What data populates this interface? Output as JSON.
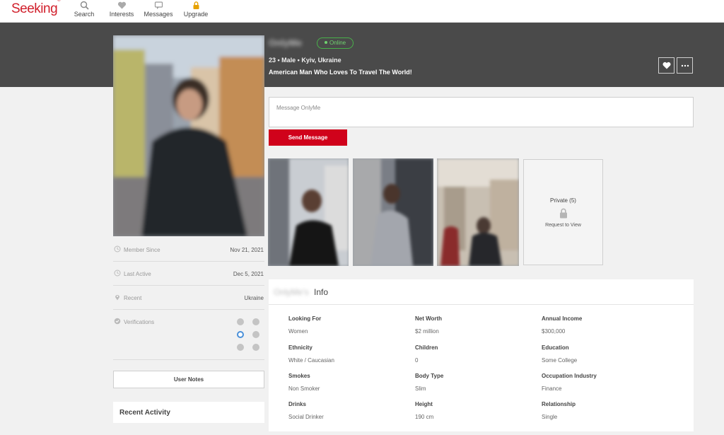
{
  "brand": {
    "logo": "Seeking",
    "color": "#d11f2b"
  },
  "nav": [
    {
      "label": "Search",
      "icon": "search-icon"
    },
    {
      "label": "Interests",
      "icon": "heart-icon"
    },
    {
      "label": "Messages",
      "icon": "chat-icon"
    },
    {
      "label": "Upgrade",
      "icon": "lock-icon"
    }
  ],
  "profile": {
    "username": "OnlyMe",
    "status": "Online",
    "meta": "23 • Male • Kyiv, Ukraine",
    "tagline": "American Man Who Loves To Travel The World!"
  },
  "message": {
    "placeholder": "Message OnlyMe",
    "send_label": "Send Message"
  },
  "gallery": {
    "private_label": "Private (5)",
    "request_label": "Request to View"
  },
  "details": [
    {
      "label": "Member Since",
      "value": "Nov 21, 2021",
      "icon": "clock-icon"
    },
    {
      "label": "Last Active",
      "value": "Dec 5, 2021",
      "icon": "clock-icon"
    },
    {
      "label": "Recent",
      "value": "Ukraine",
      "icon": "location-pin-icon"
    },
    {
      "label": "Verifications",
      "value": "",
      "icon": "check-circle-icon"
    }
  ],
  "user_notes_label": "User Notes",
  "recent_activity_label": "Recent Activity",
  "info": {
    "name": "OnlyMe's",
    "title": "Info",
    "fields": [
      {
        "label": "Looking For",
        "value": "Women"
      },
      {
        "label": "Net Worth",
        "value": "$2 million"
      },
      {
        "label": "Annual Income",
        "value": "$300,000"
      },
      {
        "label": "Ethnicity",
        "value": "White / Caucasian"
      },
      {
        "label": "Children",
        "value": "0"
      },
      {
        "label": "Education",
        "value": "Some College"
      },
      {
        "label": "Smokes",
        "value": "Non Smoker"
      },
      {
        "label": "Body Type",
        "value": "Slim"
      },
      {
        "label": "Occupation Industry",
        "value": "Finance"
      },
      {
        "label": "Drinks",
        "value": "Social Drinker"
      },
      {
        "label": "Height",
        "value": "190 cm"
      },
      {
        "label": "Relationship",
        "value": "Single"
      }
    ]
  },
  "colors": {
    "accent": "#d0021b",
    "online": "#49b14a",
    "header": "#4a4a4a"
  }
}
